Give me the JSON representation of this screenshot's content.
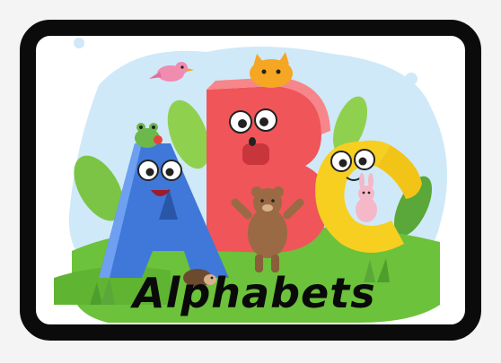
{
  "card": {
    "title": "Alphabets"
  },
  "illustration": {
    "letters": [
      "A",
      "B",
      "C"
    ],
    "colors": {
      "letter_a": "#3f78d8",
      "letter_b": "#f0555a",
      "letter_c": "#f7cf21",
      "grass": "#6cc23a",
      "sky": "#cfe9f8",
      "frame": "#0b0b0b"
    },
    "icons": [
      "bird-icon",
      "cat-icon",
      "frog-icon",
      "bear-icon",
      "bunny-icon",
      "hedgehog-icon",
      "leaf-icon"
    ]
  }
}
